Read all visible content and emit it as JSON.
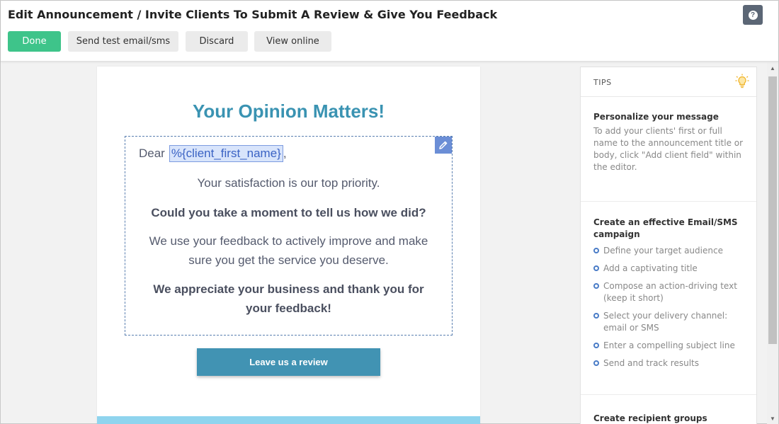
{
  "header": {
    "title": "Edit Announcement / Invite Clients To Submit A Review & Give You Feedback",
    "help_icon": "question-icon",
    "buttons": {
      "done": "Done",
      "send_test": "Send test email/sms",
      "discard": "Discard",
      "view_online": "View online"
    }
  },
  "email": {
    "title": "Your Opinion Matters!",
    "greeting": "Dear",
    "client_field": "%{client_first_name}",
    "greeting_suffix": ",",
    "para1": "Your satisfaction is our top priority.",
    "para2": "Could you take a moment to tell us how we did?",
    "para3": "We use your feedback to actively improve and make sure you get the service you deserve.",
    "para4": "We appreciate your business and thank you for your feedback!",
    "cta": "Leave us a review"
  },
  "tips": {
    "title": "TIPS",
    "sections": [
      {
        "title": "Personalize your message",
        "text": "To add your clients' first or full name to the announcement title or body, click \"Add client field\" within the editor."
      },
      {
        "title": "Create an effective Email/SMS campaign",
        "items": [
          "Define your target audience",
          "Add a captivating title",
          "Compose an action-driving text (keep it short)",
          "Select your delivery channel: email or SMS",
          "Enter a compelling subject line",
          "Send and track results"
        ]
      },
      {
        "title": "Create recipient groups"
      }
    ]
  },
  "colors": {
    "done_green": "#3ec48a",
    "title_teal": "#3a93b2",
    "cta_blue": "#4193b3",
    "field_blue": "#3b63c4"
  }
}
